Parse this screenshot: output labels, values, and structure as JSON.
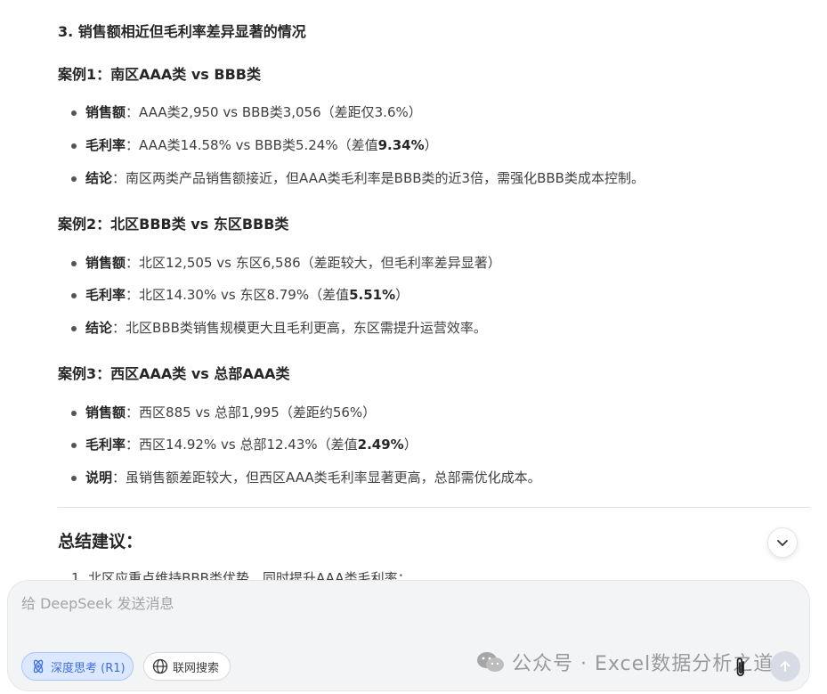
{
  "section_title": "3. 销售额相近但毛利率差异显著的情况",
  "cases": [
    {
      "title": "案例1：南区AAA类 vs BBB类",
      "items": [
        {
          "label": "销售额",
          "sep": "：",
          "text": "AAA类2,950 vs BBB类3,056（差距仅3.6%）",
          "bold": "",
          "suffix": ""
        },
        {
          "label": "毛利率",
          "sep": "：",
          "text": "AAA类14.58% vs BBB类5.24%（差值",
          "bold": "9.34%",
          "suffix": "）"
        },
        {
          "label": "结论",
          "sep": "：",
          "text": "南区两类产品销售额接近，但AAA类毛利率是BBB类的近3倍，需强化BBB类成本控制。",
          "bold": "",
          "suffix": ""
        }
      ]
    },
    {
      "title": "案例2：北区BBB类 vs 东区BBB类",
      "items": [
        {
          "label": "销售额",
          "sep": "：",
          "text": "北区12,505 vs 东区6,586（差距较大，但毛利率差异显著）",
          "bold": "",
          "suffix": ""
        },
        {
          "label": "毛利率",
          "sep": "：",
          "text": "北区14.30% vs 东区8.79%（差值",
          "bold": "5.51%",
          "suffix": "）"
        },
        {
          "label": "结论",
          "sep": "：",
          "text": "北区BBB类销售规模更大且毛利更高，东区需提升运营效率。",
          "bold": "",
          "suffix": ""
        }
      ]
    },
    {
      "title": "案例3：西区AAA类 vs 总部AAA类",
      "items": [
        {
          "label": "销售额",
          "sep": "：",
          "text": "西区885 vs 总部1,995（差距约56%）",
          "bold": "",
          "suffix": ""
        },
        {
          "label": "毛利率",
          "sep": "：",
          "text": "西区14.92% vs 总部12.43%（差值",
          "bold": "2.49%",
          "suffix": "）"
        },
        {
          "label": "说明",
          "sep": "：",
          "text": "虽销售额差距较大，但西区AAA类毛利率显著更高，总部需优化成本。",
          "bold": "",
          "suffix": ""
        }
      ]
    }
  ],
  "summary": {
    "title": "总结建议：",
    "first_item": "1. 北区应重点维持BBB类优势，同时提升AAA类毛利率；"
  },
  "composer": {
    "placeholder": "给 DeepSeek 发送消息",
    "deep_think_label": "深度思考 (R1)",
    "web_search_label": "联网搜索"
  },
  "watermark": {
    "text": "公众号 · Excel数据分析之道"
  },
  "icons": {
    "collapse": "chevron-down-icon",
    "deep_think": "atom-icon",
    "web_search": "globe-icon",
    "attach": "paperclip-icon",
    "send": "arrow-up-icon",
    "watermark": "wechat-icon"
  },
  "colors": {
    "deep_think_accent": "#3f6ee0",
    "heading": "#262626",
    "body_text": "#404040"
  }
}
